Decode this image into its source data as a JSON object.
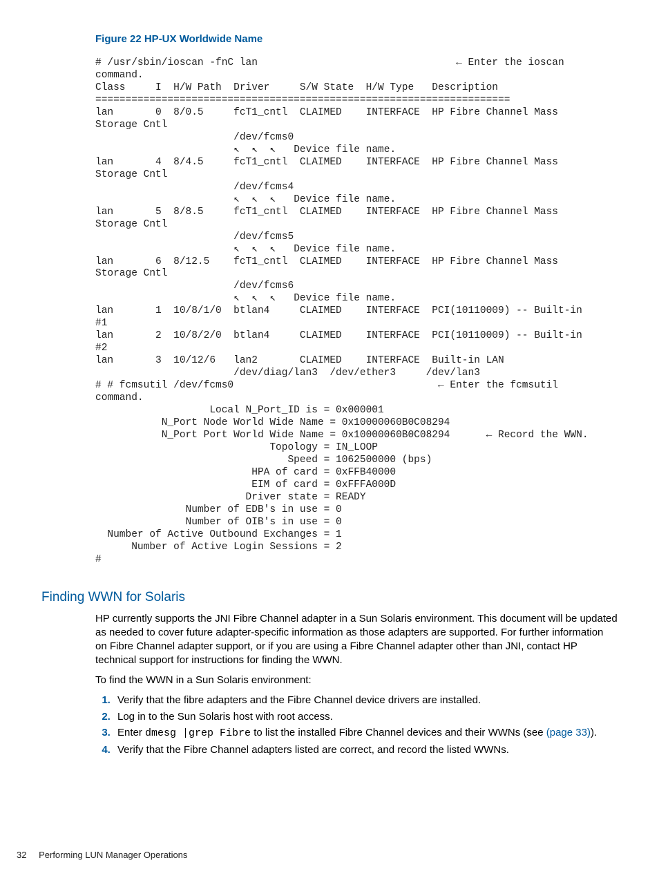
{
  "figure_title": "Figure 22 HP-UX Worldwide Name",
  "console": "# /usr/sbin/ioscan -fnC lan                                 ← Enter the ioscan\ncommand.\nClass     I  H/W Path  Driver     S/W State  H/W Type   Description\n=====================================================================\nlan       0  8/0.5     fcT1_cntl  CLAIMED    INTERFACE  HP Fibre Channel Mass\nStorage Cntl\n                       /dev/fcms0\n                       ↖  ↖  ↖   Device file name.\nlan       4  8/4.5     fcT1_cntl  CLAIMED    INTERFACE  HP Fibre Channel Mass\nStorage Cntl\n                       /dev/fcms4\n                       ↖  ↖  ↖   Device file name.\nlan       5  8/8.5     fcT1_cntl  CLAIMED    INTERFACE  HP Fibre Channel Mass\nStorage Cntl\n                       /dev/fcms5\n                       ↖  ↖  ↖   Device file name.\nlan       6  8/12.5    fcT1_cntl  CLAIMED    INTERFACE  HP Fibre Channel Mass\nStorage Cntl\n                       /dev/fcms6\n                       ↖  ↖  ↖   Device file name.\nlan       1  10/8/1/0  btlan4     CLAIMED    INTERFACE  PCI(10110009) -- Built-in\n#1\nlan       2  10/8/2/0  btlan4     CLAIMED    INTERFACE  PCI(10110009) -- Built-in\n#2\nlan       3  10/12/6   lan2       CLAIMED    INTERFACE  Built-in LAN\n                       /dev/diag/lan3  /dev/ether3     /dev/lan3\n# # fcmsutil /dev/fcms0                                  ← Enter the fcmsutil\ncommand.\n                   Local N_Port_ID is = 0x000001\n           N_Port Node World Wide Name = 0x10000060B0C08294\n           N_Port Port World Wide Name = 0x10000060B0C08294      ← Record the WWN.\n                             Topology = IN_LOOP\n                                Speed = 1062500000 (bps)\n                          HPA of card = 0xFFB40000\n                          EIM of card = 0xFFFA000D\n                         Driver state = READY\n               Number of EDB's in use = 0\n               Number of OIB's in use = 0\n  Number of Active Outbound Exchanges = 1\n      Number of Active Login Sessions = 2\n#",
  "section_heading": "Finding WWN for Solaris",
  "para1": "HP currently supports the JNI Fibre Channel adapter in a Sun Solaris environment. This document will be updated as needed to cover future adapter-specific information as those adapters are supported. For further information on Fibre Channel adapter support, or if you are using a Fibre Channel adapter other than JNI, contact HP technical support for instructions for finding the WWN.",
  "para2": "To find the WWN in a Sun Solaris environment:",
  "steps": {
    "s1": "Verify that the fibre adapters and the Fibre Channel device drivers are installed.",
    "s2": "Log in to the Sun Solaris host with root access.",
    "s3_pre": "Enter ",
    "s3_cmd": "dmesg |grep Fibre",
    "s3_mid": " to list the installed Fibre Channel devices and their WWNs (see ",
    "s3_link": "(page 33)",
    "s3_post": ").",
    "s4": "Verify that the Fibre Channel adapters listed are correct, and record the listed WWNs."
  },
  "footer": {
    "page": "32",
    "chapter": "Performing LUN Manager Operations"
  }
}
